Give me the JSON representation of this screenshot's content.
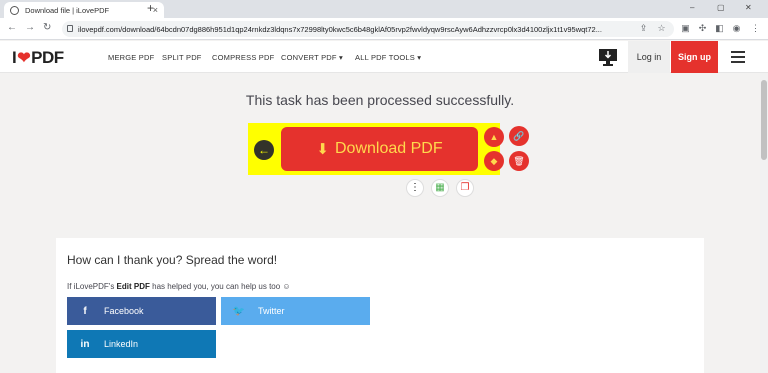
{
  "browser": {
    "tab_title": "Download file | iLovePDF",
    "tab_close": "×",
    "new_tab": "+",
    "url": "ilovepdf.com/download/64bcdn07dg886h951d1qp24rnkdz3ldqns7x72998lty0kwc5c6b48gklAf05rvp2fwvldyqw9rscAyw6Adhzzvrcp0lx3d4100zljx1t1v95wqt72...",
    "win_min": "–",
    "win_max": "▢",
    "win_close": "✕"
  },
  "header": {
    "logo_left": "I",
    "logo_heart": "❤",
    "logo_right": "PDF",
    "nav": {
      "merge": "MERGE PDF",
      "split": "SPLIT PDF",
      "compress": "COMPRESS PDF",
      "convert": "CONVERT PDF ▾",
      "all_tools": "ALL PDF TOOLS ▾"
    },
    "login_label": "Log in",
    "signup_label": "Sign up"
  },
  "main": {
    "success_message": "This task has been processed successfully.",
    "download_label": "Download PDF"
  },
  "share": {
    "title": "How can I thank you? Spread the word!",
    "subtitle_prefix": "If iLovePDF's ",
    "subtitle_bold": "Edit PDF",
    "subtitle_suffix": " has helped you, you can help us too ☺",
    "facebook_label": "Facebook",
    "facebook_icon": "f",
    "twitter_label": "Twitter",
    "twitter_icon": "🐦",
    "linkedin_label": "LinkedIn",
    "linkedin_icon": "in"
  },
  "colors": {
    "brand_red": "#e5322d",
    "highlight_yellow": "#ffff00",
    "facebook": "#3a5b9a",
    "twitter": "#5aacee",
    "linkedin": "#0f78b5"
  },
  "icons": {
    "back": "arrow-left-icon",
    "download": "download-icon",
    "drive": "google-drive-icon",
    "dropbox": "dropbox-icon",
    "link": "link-icon",
    "delete": "trash-icon",
    "more": "more-vertical-icon"
  }
}
